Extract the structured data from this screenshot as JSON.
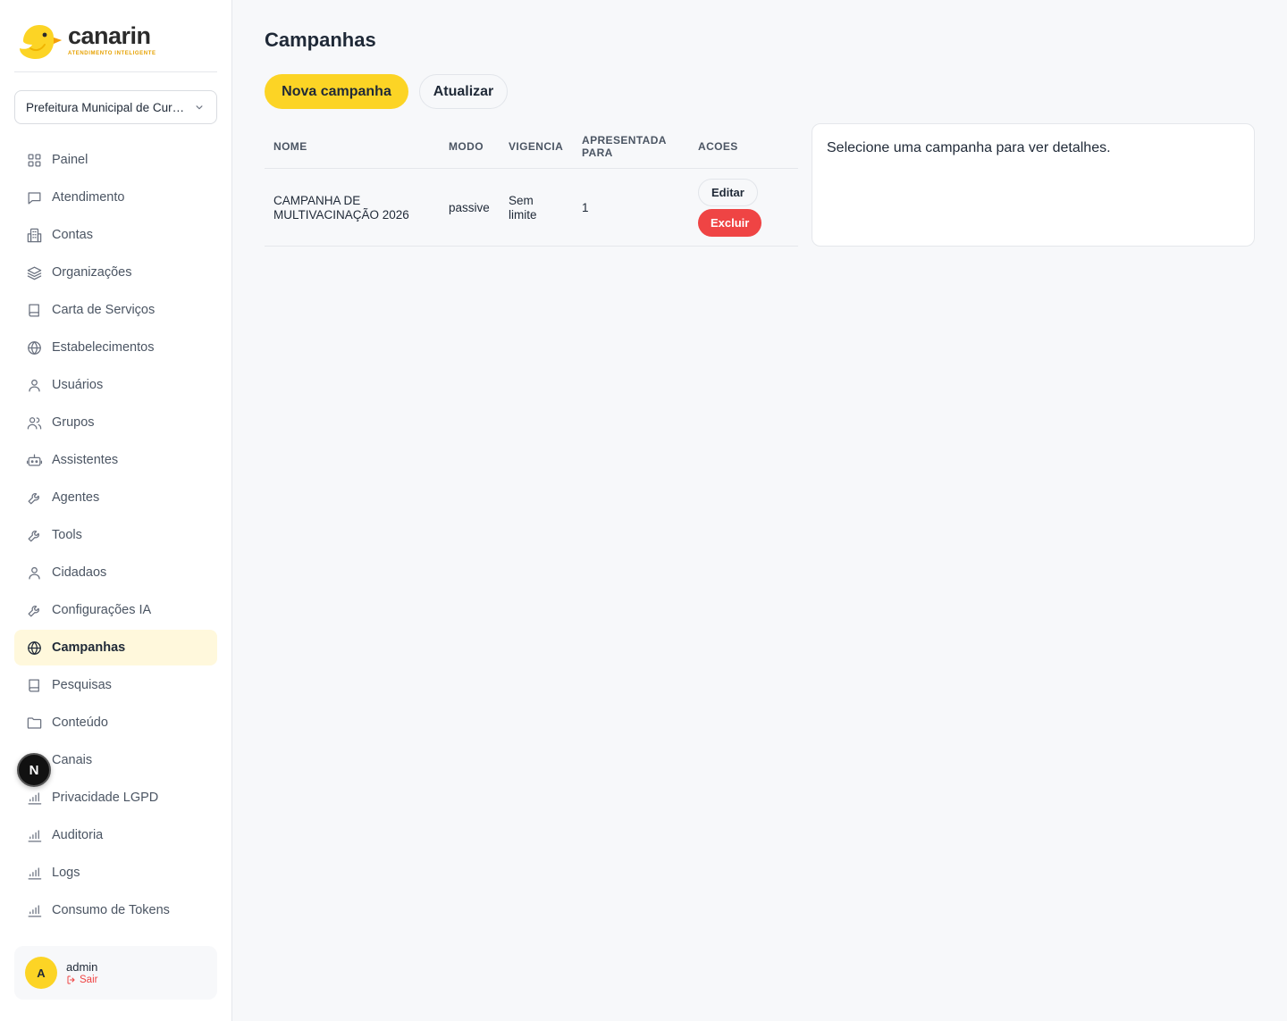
{
  "brand": {
    "name": "canarin",
    "tagline": "ATENDIMENTO INTELIGENTE",
    "accent": "#fcd425"
  },
  "org_select": {
    "value": "Prefeitura Municipal de Cur…"
  },
  "nav": [
    {
      "label": "Painel",
      "icon": "grid-icon"
    },
    {
      "label": "Atendimento",
      "icon": "chat-icon"
    },
    {
      "label": "Contas",
      "icon": "building-icon"
    },
    {
      "label": "Organizações",
      "icon": "layers-icon"
    },
    {
      "label": "Carta de Serviços",
      "icon": "book-icon"
    },
    {
      "label": "Estabelecimentos",
      "icon": "globe-icon"
    },
    {
      "label": "Usuários",
      "icon": "user-icon"
    },
    {
      "label": "Grupos",
      "icon": "users-icon"
    },
    {
      "label": "Assistentes",
      "icon": "bot-icon"
    },
    {
      "label": "Agentes",
      "icon": "wrench-icon"
    },
    {
      "label": "Tools",
      "icon": "wrench-icon"
    },
    {
      "label": "Cidadaos",
      "icon": "user-icon"
    },
    {
      "label": "Configurações IA",
      "icon": "wrench-icon"
    },
    {
      "label": "Campanhas",
      "icon": "globe-icon",
      "active": true
    },
    {
      "label": "Pesquisas",
      "icon": "book-icon"
    },
    {
      "label": "Conteúdo",
      "icon": "folder-icon"
    },
    {
      "label": "Canais",
      "icon": "chart-icon"
    },
    {
      "label": "Privacidade LGPD",
      "icon": "chart-icon"
    },
    {
      "label": "Auditoria",
      "icon": "chart-icon"
    },
    {
      "label": "Logs",
      "icon": "chart-icon"
    },
    {
      "label": "Consumo de Tokens",
      "icon": "chart-icon"
    }
  ],
  "user": {
    "initial": "A",
    "name": "admin",
    "logout": "Sair"
  },
  "dev_badge": "N",
  "page": {
    "title": "Campanhas",
    "new_button": "Nova campanha",
    "refresh_button": "Atualizar"
  },
  "table": {
    "headers": {
      "nome": "NOME",
      "modo": "MODO",
      "vigencia": "VIGENCIA",
      "apresentada": "APRESENTADA PARA",
      "acoes": "ACOES"
    },
    "rows": [
      {
        "nome": "CAMPANHA DE MULTIVACINAÇÃO 2026",
        "modo": "passive",
        "vigencia": "Sem limite",
        "apresentada": "1",
        "edit": "Editar",
        "delete": "Excluir"
      }
    ]
  },
  "details": {
    "placeholder": "Selecione uma campanha para ver detalhes."
  }
}
